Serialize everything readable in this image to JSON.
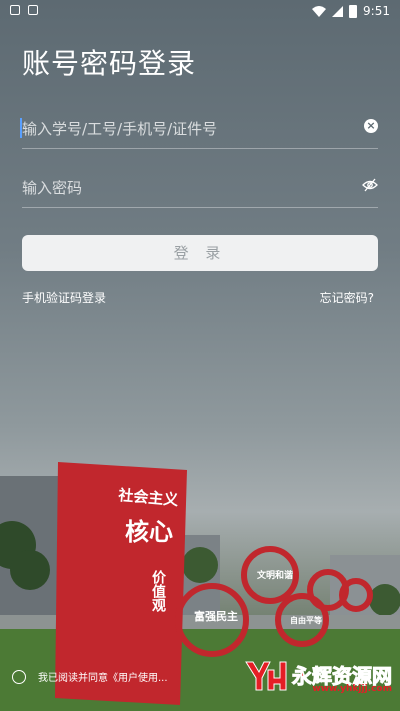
{
  "status": {
    "time": "9:51"
  },
  "page": {
    "title": "账号密码登录"
  },
  "form": {
    "account_placeholder": "输入学号/工号/手机号/证件号",
    "password_placeholder": "输入密码",
    "login_label": "登 录",
    "sms_login_link": "手机验证码登录",
    "forgot_link": "忘记密码?"
  },
  "agreement": {
    "text": "我已阅读并同意《用户使用..."
  },
  "watermark": {
    "brand": "永辉资源网",
    "url": "www.yhkjjj.com"
  },
  "poster": {
    "line1": "社会主义",
    "line2": "核心",
    "line3": "价值观"
  },
  "circles": [
    "富强民主",
    "文明和谐",
    "自由平等"
  ]
}
